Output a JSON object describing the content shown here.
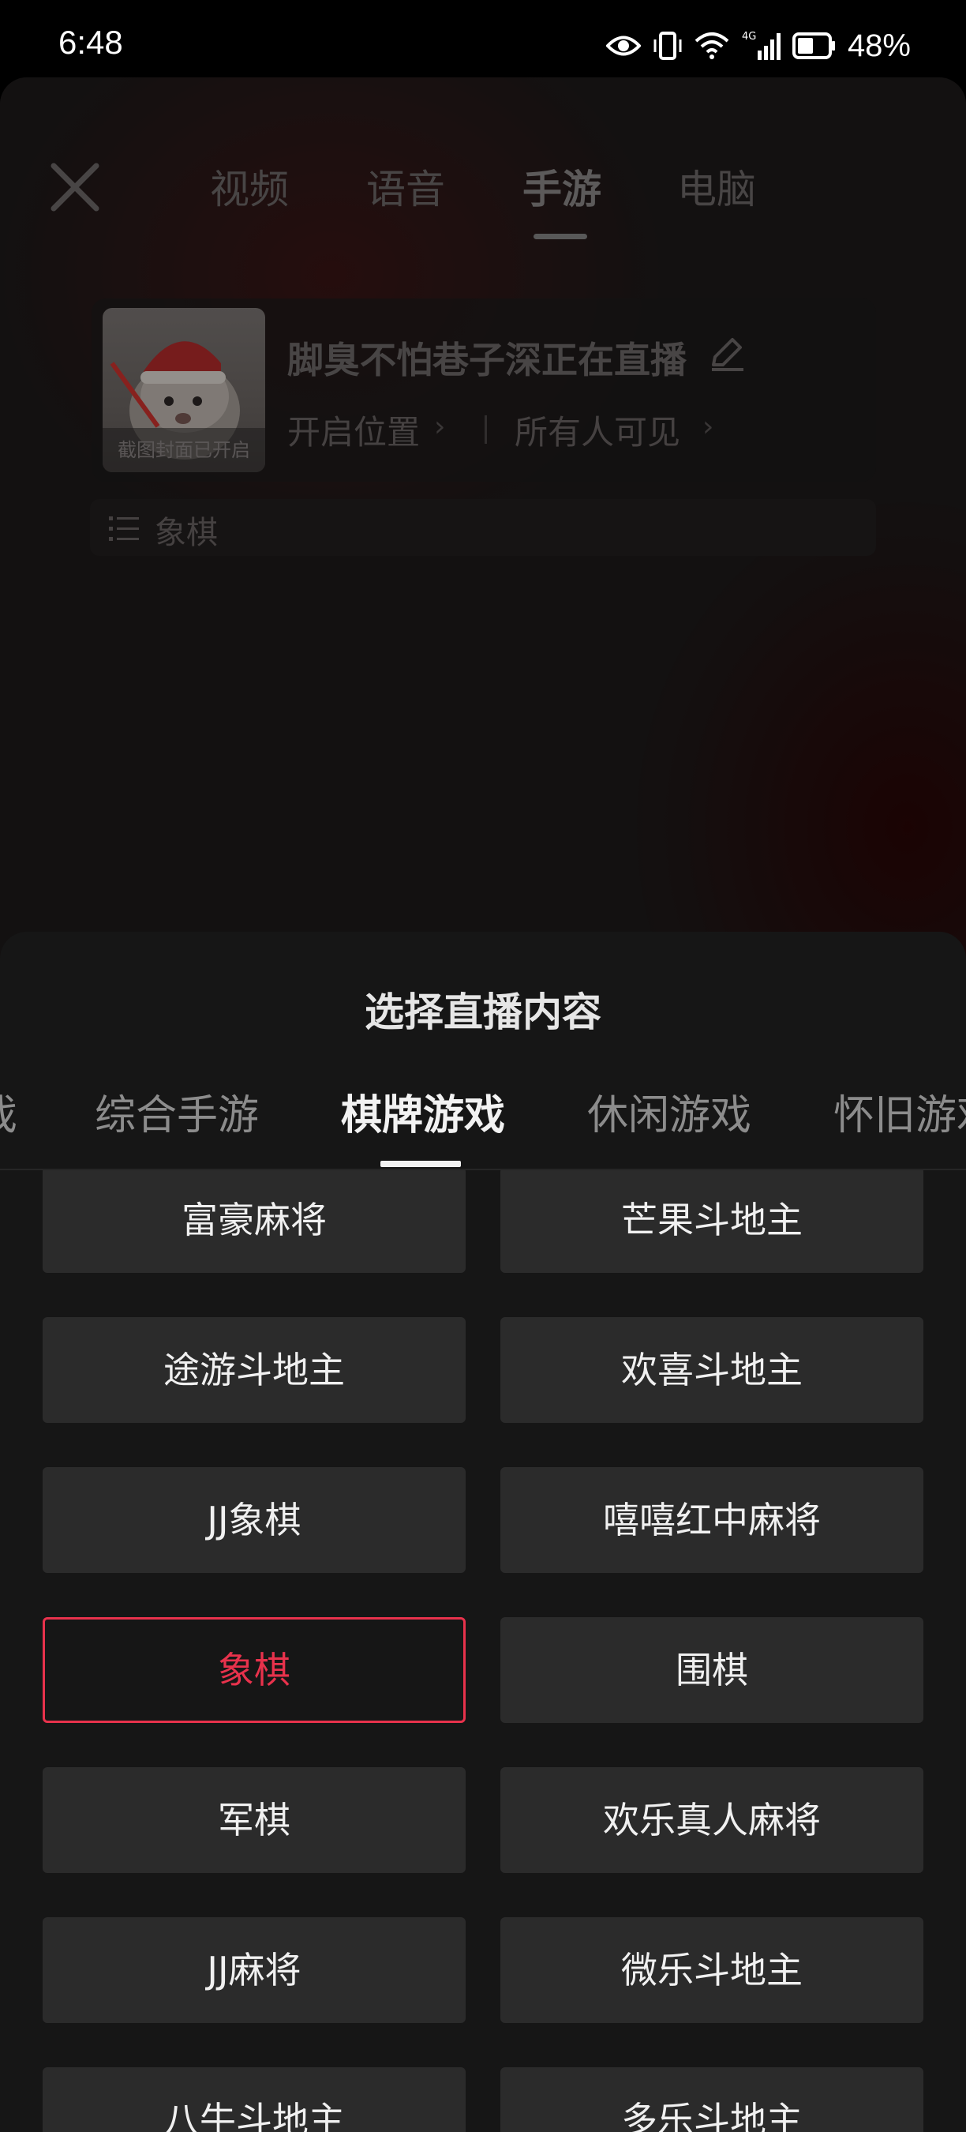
{
  "status_bar": {
    "time": "6:48",
    "battery": "48%",
    "network": "4G",
    "icons": [
      "eye-icon",
      "vibrate-icon",
      "wifi-icon",
      "signal-icon",
      "battery-icon"
    ]
  },
  "top_tabs": [
    {
      "label": "视频",
      "active": false
    },
    {
      "label": "语音",
      "active": false
    },
    {
      "label": "手游",
      "active": true
    },
    {
      "label": "电脑",
      "active": false
    }
  ],
  "stream_info": {
    "cover_caption": "截图封面已开启",
    "title": "脚臭不怕巷子深正在直播",
    "location_label": "开启位置",
    "visibility_label": "所有人可见",
    "category": "象棋"
  },
  "sheet": {
    "title": "选择直播内容",
    "category_tabs": [
      {
        "label": "戏",
        "active": false
      },
      {
        "label": "综合手游",
        "active": false
      },
      {
        "label": "棋牌游戏",
        "active": true
      },
      {
        "label": "休闲游戏",
        "active": false
      },
      {
        "label": "怀旧游戏",
        "active": false
      }
    ],
    "games": [
      {
        "label": "富豪麻将",
        "selected": false
      },
      {
        "label": "芒果斗地主",
        "selected": false
      },
      {
        "label": "途游斗地主",
        "selected": false
      },
      {
        "label": "欢喜斗地主",
        "selected": false
      },
      {
        "label": "JJ象棋",
        "selected": false
      },
      {
        "label": "嘻嘻红中麻将",
        "selected": false
      },
      {
        "label": "象棋",
        "selected": true
      },
      {
        "label": "围棋",
        "selected": false
      },
      {
        "label": "军棋",
        "selected": false
      },
      {
        "label": "欢乐真人麻将",
        "selected": false
      },
      {
        "label": "JJ麻将",
        "selected": false
      },
      {
        "label": "微乐斗地主",
        "selected": false
      },
      {
        "label": "八牛斗地主",
        "selected": false
      },
      {
        "label": "多乐斗地主",
        "selected": false
      }
    ]
  },
  "colors": {
    "accent": "#e8324c",
    "sheet_bg": "#161616",
    "tile_bg": "#2b2b2b"
  }
}
